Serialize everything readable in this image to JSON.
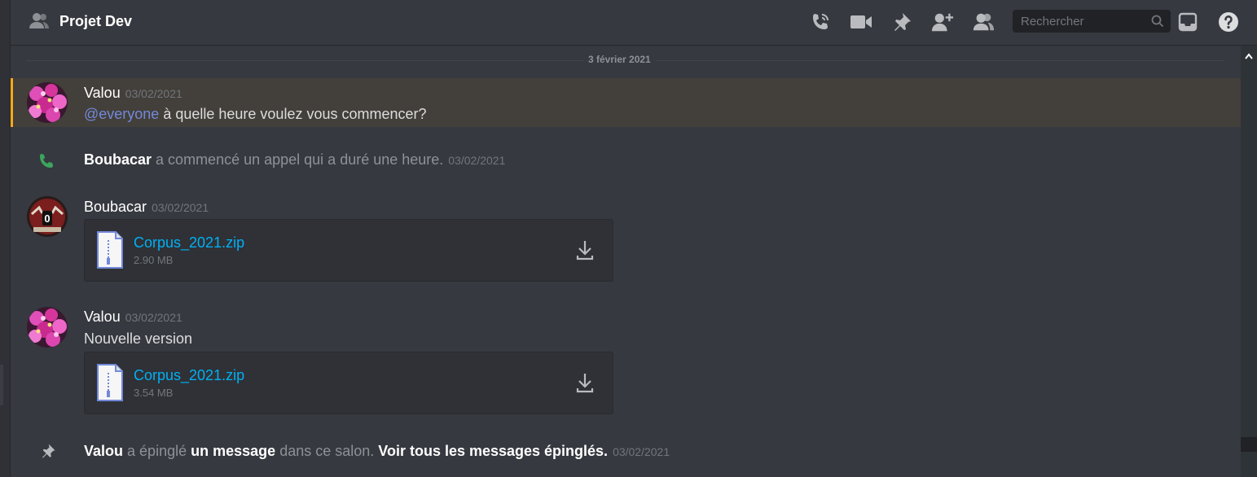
{
  "header": {
    "channel_name": "Projet Dev",
    "icons": [
      "group-icon",
      "call-icon",
      "video-icon",
      "pin-icon",
      "add-member-icon",
      "members-icon",
      "inbox-icon",
      "help-icon"
    ]
  },
  "search": {
    "placeholder": "Rechercher"
  },
  "divider": {
    "date": "3 février 2021"
  },
  "messages": [
    {
      "author": "Valou",
      "timestamp": "03/02/2021",
      "mention": "@everyone",
      "text": " à quelle heure voulez vous commencer?"
    },
    {
      "author": "Boubacar",
      "text": "a commencé un appel qui a duré une heure.",
      "timestamp": "03/02/2021"
    },
    {
      "author": "Boubacar",
      "timestamp": "03/02/2021",
      "attachment": {
        "name": "Corpus_2021.zip",
        "size": "2.90 MB"
      }
    },
    {
      "author": "Valou",
      "timestamp": "03/02/2021",
      "text": "Nouvelle version",
      "attachment": {
        "name": "Corpus_2021.zip",
        "size": "3.54 MB"
      }
    },
    {
      "author": "Valou",
      "text_1": "a épinglé",
      "link_1": "un message",
      "text_2": "dans ce salon.",
      "link_2": "Voir tous les messages épinglés.",
      "timestamp": "03/02/2021"
    }
  ],
  "colors": {
    "accent": "#7289da",
    "link": "#00b0f4",
    "highlight_bar": "#faa81a",
    "call_green": "#3ba55c"
  }
}
